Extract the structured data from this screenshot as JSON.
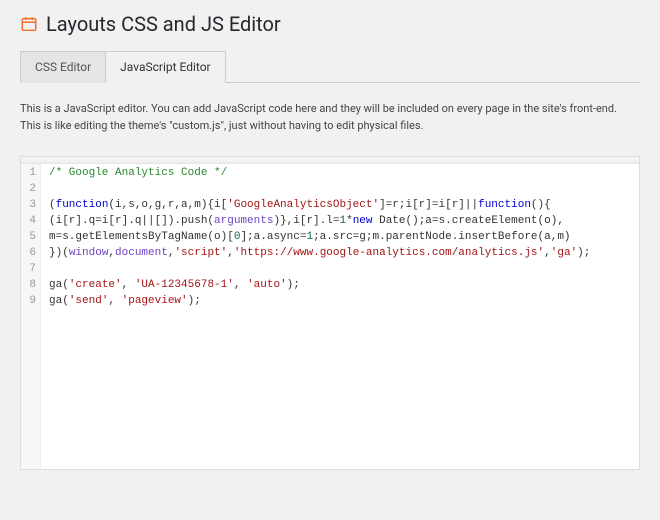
{
  "header": {
    "icon": "calendar-icon",
    "title": "Layouts CSS and JS Editor"
  },
  "tabs": {
    "css": {
      "label": "CSS Editor"
    },
    "js": {
      "label": "JavaScript Editor"
    }
  },
  "active_tab": "js",
  "panel": {
    "description": "This is a JavaScript editor. You can add JavaScript code here and they will be included on every page in the site's front-end. This is like editing the theme's \"custom.js\", just without having to edit physical files."
  },
  "editor": {
    "line_count": 9,
    "gutter": [
      "1",
      "2",
      "3",
      "4",
      "5",
      "6",
      "7",
      "8",
      "9"
    ],
    "code_tokens": [
      [
        {
          "t": "/* Google Analytics Code */",
          "c": "c-comment"
        }
      ],
      [],
      [
        {
          "t": "(",
          "c": "c-punc"
        },
        {
          "t": "function",
          "c": "c-kw"
        },
        {
          "t": "(i,s,o,g,r,a,m){i[",
          "c": "c-id"
        },
        {
          "t": "'GoogleAnalyticsObject'",
          "c": "c-str"
        },
        {
          "t": "]=r;i[r]=i[r]||",
          "c": "c-id"
        },
        {
          "t": "function",
          "c": "c-kw"
        },
        {
          "t": "(){",
          "c": "c-id"
        }
      ],
      [
        {
          "t": "(i[r].q=i[r].q||[]).push(",
          "c": "c-id"
        },
        {
          "t": "arguments",
          "c": "c-lit"
        },
        {
          "t": ")},i[r].l=",
          "c": "c-id"
        },
        {
          "t": "1",
          "c": "c-num"
        },
        {
          "t": "*",
          "c": "c-id"
        },
        {
          "t": "new",
          "c": "c-kw"
        },
        {
          "t": " Date();a=s.createElement(o),",
          "c": "c-id"
        }
      ],
      [
        {
          "t": "m=s.getElementsByTagName(o)[",
          "c": "c-id"
        },
        {
          "t": "0",
          "c": "c-num"
        },
        {
          "t": "];a.async=",
          "c": "c-id"
        },
        {
          "t": "1",
          "c": "c-num"
        },
        {
          "t": ";a.src=g;m.parentNode.insertBefore(a,m)",
          "c": "c-id"
        }
      ],
      [
        {
          "t": "})(",
          "c": "c-id"
        },
        {
          "t": "window",
          "c": "c-lit"
        },
        {
          "t": ",",
          "c": "c-punc"
        },
        {
          "t": "document",
          "c": "c-lit"
        },
        {
          "t": ",",
          "c": "c-punc"
        },
        {
          "t": "'script'",
          "c": "c-str"
        },
        {
          "t": ",",
          "c": "c-punc"
        },
        {
          "t": "'https://www.google-analytics.com/analytics.js'",
          "c": "c-str"
        },
        {
          "t": ",",
          "c": "c-punc"
        },
        {
          "t": "'ga'",
          "c": "c-str"
        },
        {
          "t": ");",
          "c": "c-punc"
        }
      ],
      [],
      [
        {
          "t": "ga(",
          "c": "c-id"
        },
        {
          "t": "'create'",
          "c": "c-str"
        },
        {
          "t": ", ",
          "c": "c-punc"
        },
        {
          "t": "'UA-12345678-1'",
          "c": "c-str"
        },
        {
          "t": ", ",
          "c": "c-punc"
        },
        {
          "t": "'auto'",
          "c": "c-str"
        },
        {
          "t": ");",
          "c": "c-punc"
        }
      ],
      [
        {
          "t": "ga(",
          "c": "c-id"
        },
        {
          "t": "'send'",
          "c": "c-str"
        },
        {
          "t": ", ",
          "c": "c-punc"
        },
        {
          "t": "'pageview'",
          "c": "c-str"
        },
        {
          "t": ");",
          "c": "c-punc"
        }
      ]
    ]
  }
}
